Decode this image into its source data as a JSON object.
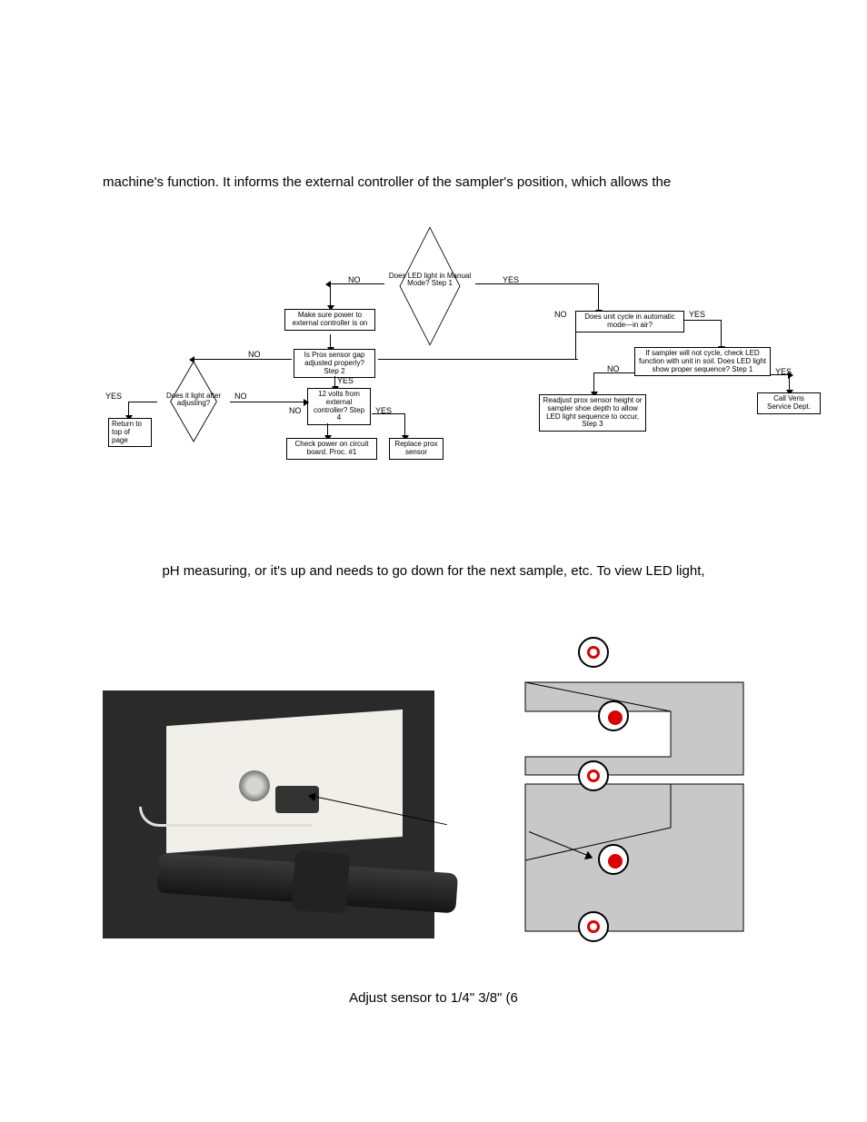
{
  "text": {
    "line1": "machine's function.  It informs the external controller of the sampler's position, which allows the",
    "line2": "pH measuring, or it's up and needs to go down for the next sample, etc. To view LED light,",
    "line3": "Adjust sensor to 1/4\"  3/8\" (6"
  },
  "flow": {
    "d1": "Does LED light in Manual Mode? Step 1",
    "d1_no": "NO",
    "d1_yes": "YES",
    "b_power": "Make sure power to external controller is on",
    "b_cycle": "Does unit cycle in automatic mode—in air?",
    "c_no": "NO",
    "c_yes": "YES",
    "b_gap": "Is Prox sensor gap adjusted properly? Step 2",
    "g_no": "NO",
    "g_yes": "YES",
    "b_seq": "If sampler will not cycle, check LED function with unit in soil. Does LED light show proper sequence? Step 1",
    "s_no": "NO",
    "s_yes": "YES",
    "b_12v": "12 volts from external controller? Step 4",
    "v_no": "NO",
    "v_yes": "YES",
    "b_pcb": "Check power on circuit board. Proc. #1",
    "b_repl": "Replace prox sensor",
    "b_readj": "Readjust prox sensor height or sampler shoe depth to allow LED light sequence to occur, Step 3",
    "b_call": "Call Veris Service Dept.",
    "d2": "Does it light after adjusting?",
    "d2_no": "NO",
    "d2_yes": "YES",
    "b_ret": "Return to top of page"
  },
  "diagram": {
    "led1": "ring",
    "led2": "fill",
    "led3": "ring",
    "led4": "fill",
    "led5": "ring"
  }
}
